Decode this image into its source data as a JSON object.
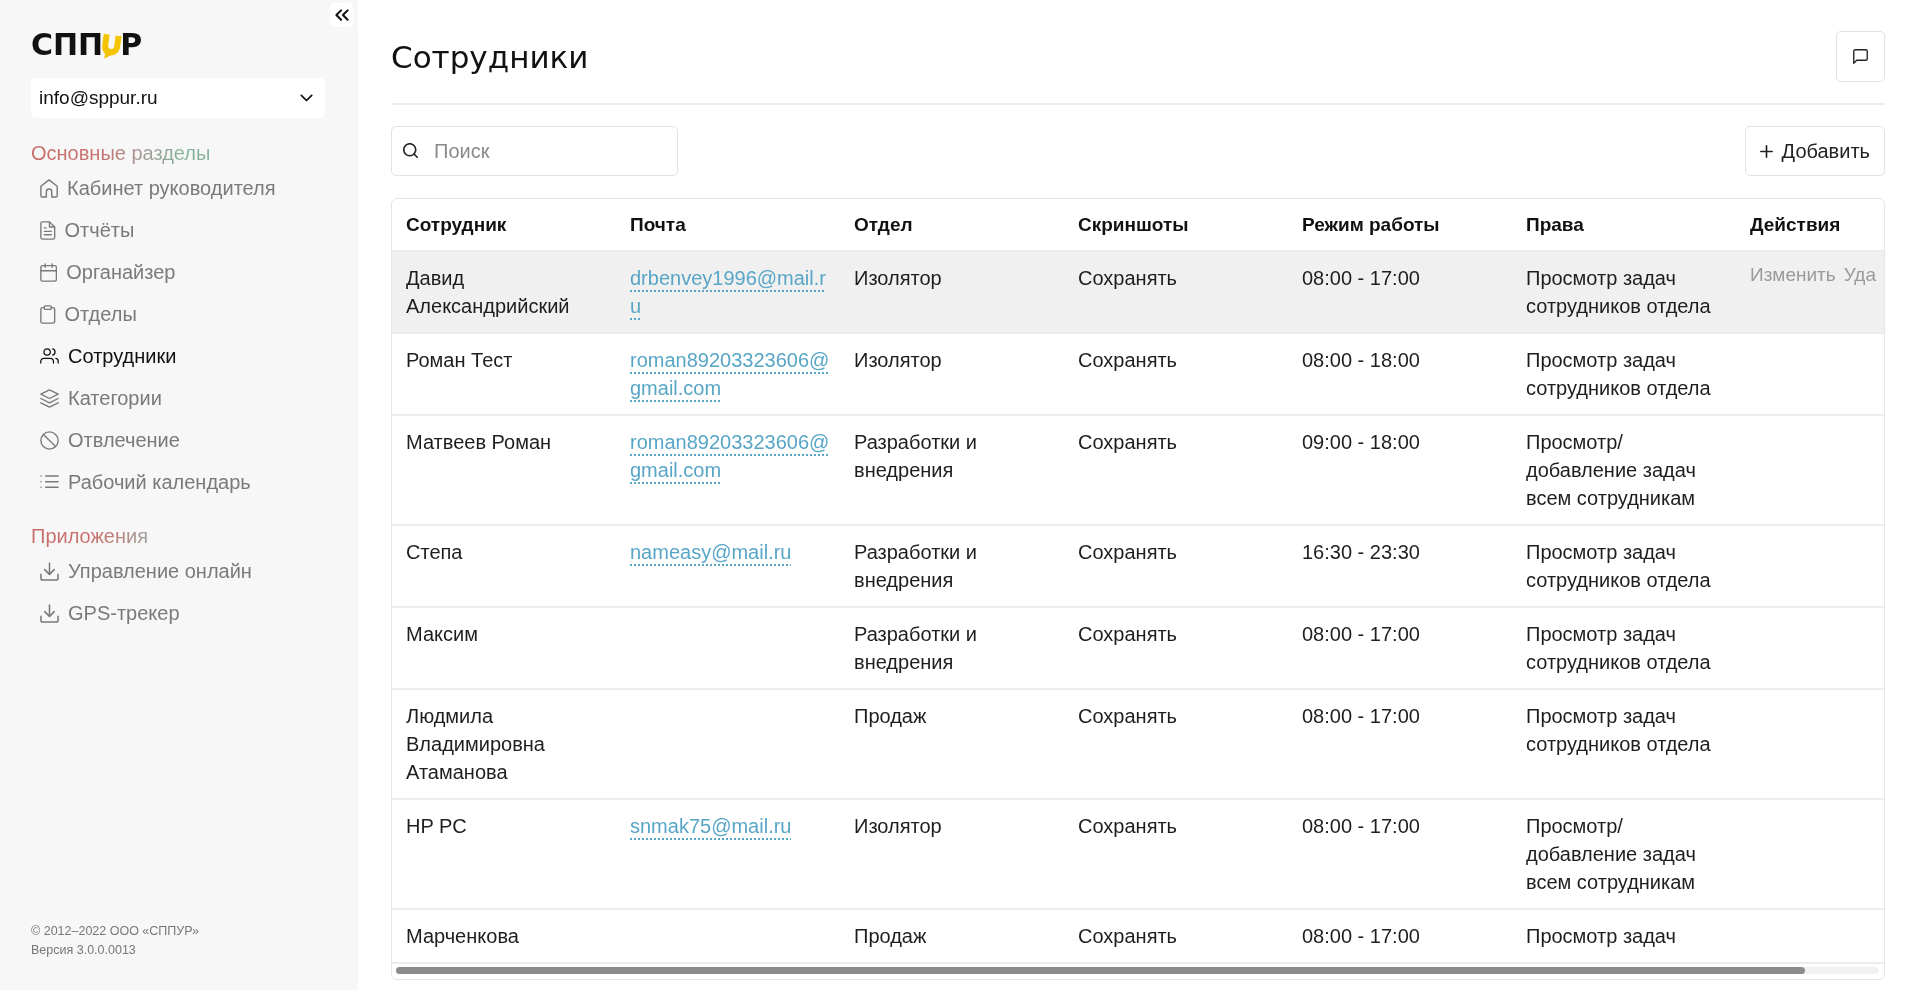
{
  "sidebar": {
    "logo": {
      "text_left": "СПП",
      "text_right": "Р"
    },
    "account_select": {
      "value": "info@sppur.ru"
    },
    "sections": [
      {
        "title": "Основные разделы",
        "items": [
          {
            "label": "Кабинет руководителя",
            "selected": false
          },
          {
            "label": "Отчёты",
            "selected": false
          },
          {
            "label": "Органайзер",
            "selected": false
          },
          {
            "label": "Отделы",
            "selected": false
          },
          {
            "label": "Сотрудники",
            "selected": true
          },
          {
            "label": "Категории",
            "selected": false
          },
          {
            "label": "Отвлечение",
            "selected": false
          },
          {
            "label": "Рабочий календарь",
            "selected": false
          }
        ]
      },
      {
        "title": "Приложения",
        "items": [
          {
            "label": "Управление онлайн",
            "selected": false
          },
          {
            "label": "GPS-трекер",
            "selected": false
          }
        ]
      }
    ],
    "footer": {
      "copyright": "© 2012–2022 ООО «СППУР»",
      "version": "Версия 3.0.0.0013"
    }
  },
  "page": {
    "title": "Сотрудники"
  },
  "toolbar": {
    "search": {
      "placeholder": "Поиск"
    },
    "add_button": "Добавить"
  },
  "table": {
    "columns": [
      "Сотрудник",
      "Почта",
      "Отдел",
      "Скриншоты",
      "Режим работы",
      "Права",
      "Действия"
    ],
    "rows": [
      {
        "employee": "Давид Александрийский",
        "email": "drbenvey1996@mail.ru",
        "department": "Изолятор",
        "screenshots": "Сохранять",
        "schedule": "08:00 - 17:00",
        "rights": "Просмотр задач сотрудников отдела",
        "actions": [
          "Изменить",
          "Уда"
        ],
        "hovered": true
      },
      {
        "employee": "Роман Тест",
        "email": "roman89203323606@gmail.com",
        "department": "Изолятор",
        "screenshots": "Сохранять",
        "schedule": "08:00 - 18:00",
        "rights": "Просмотр задач сотрудников отдела",
        "hovered": false
      },
      {
        "employee": "Матвеев Роман",
        "email": "roman89203323606@gmail.com",
        "department": "Разработки и внедрения",
        "screenshots": "Сохранять",
        "schedule": "09:00 - 18:00",
        "rights": "Просмотр/добавление задач всем сотрудникам",
        "hovered": false
      },
      {
        "employee": "Степа",
        "email": "nameasy@mail.ru",
        "department": "Разработки и внедрения",
        "screenshots": "Сохранять",
        "schedule": "16:30 - 23:30",
        "rights": "Просмотр задач сотрудников отдела",
        "hovered": false
      },
      {
        "employee": "Максим",
        "department": "Разработки и внедрения",
        "screenshots": "Сохранять",
        "schedule": "08:00 - 17:00",
        "rights": "Просмотр задач сотрудников отдела",
        "hovered": false
      },
      {
        "employee": "Людмила Владимировна Атаманова",
        "department": "Продаж",
        "screenshots": "Сохранять",
        "schedule": "08:00 - 17:00",
        "rights": "Просмотр задач сотрудников отдела",
        "hovered": false
      },
      {
        "employee": "HP PC",
        "email": "snmak75@mail.ru",
        "department": "Изолятор",
        "screenshots": "Сохранять",
        "schedule": "08:00 - 17:00",
        "rights": "Просмотр/добавление задач всем сотрудникам",
        "hovered": false
      },
      {
        "employee": "Марченкова",
        "department": "Продаж",
        "screenshots": "Сохранять",
        "schedule": "08:00 - 17:00",
        "rights": "Просмотр задач",
        "hovered": false
      }
    ]
  }
}
